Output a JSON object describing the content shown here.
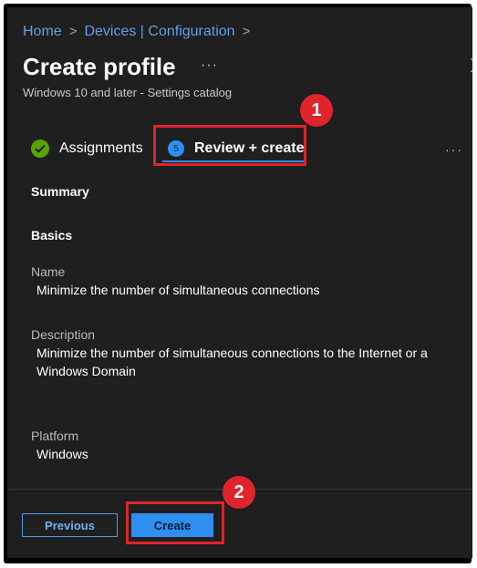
{
  "breadcrumb": {
    "items": [
      "Home",
      "Devices | Configuration"
    ]
  },
  "page": {
    "title": "Create profile",
    "title_more": "···",
    "subtitle": "Windows 10 and later - Settings catalog"
  },
  "steps": {
    "assignments": "Assignments",
    "review_number": "5",
    "review_create": "Review + create",
    "more": "···"
  },
  "summary": {
    "heading": "Summary",
    "basics_heading": "Basics",
    "name_label": "Name",
    "name_value": "Minimize the number of simultaneous connections",
    "description_label": "Description",
    "description_value": "Minimize the number of simultaneous connections to the Internet or a Windows Domain",
    "platform_label": "Platform",
    "platform_value": "Windows"
  },
  "footer": {
    "previous_label": "Previous",
    "create_label": "Create"
  },
  "annotations": {
    "badge_1": "1",
    "badge_2": "2"
  },
  "colors": {
    "panel_bg": "#1f1f1f",
    "accent_blue": "#2f8ff0",
    "success_green": "#57a300",
    "highlight_red": "#e0242c"
  }
}
